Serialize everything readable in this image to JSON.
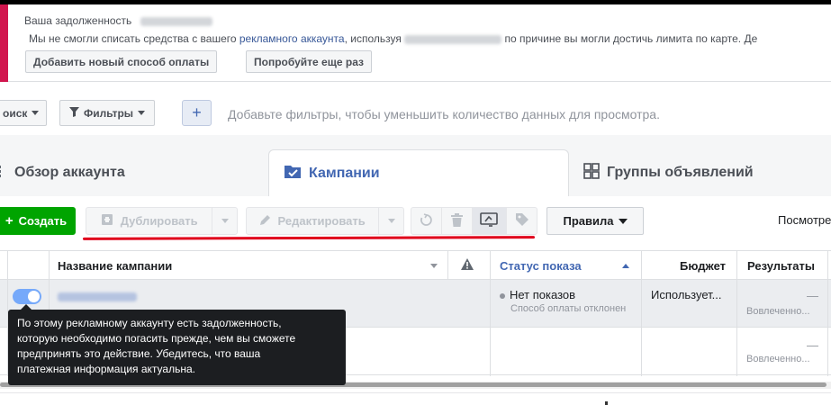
{
  "alert": {
    "title": "Ваша задолженность",
    "message_prefix": "Мы не смогли списать средства с вашего ",
    "message_link": "рекламного аккаунта",
    "message_middle": ", используя ",
    "message_suffix": " по причине вы могли достичь лимита по карте. Де",
    "add_payment_label": "Добавить новый способ оплаты",
    "retry_label": "Попробуйте еще раз",
    "accent_color": "#d1164e"
  },
  "filters": {
    "search_label": "оиск",
    "filters_label": "Фильтры",
    "add_label": "+",
    "hint": "Добавьте фильтры, чтобы уменьшить количество данных для просмотра."
  },
  "tabs": [
    {
      "label": "Обзор аккаунта",
      "icon": "overview-icon"
    },
    {
      "label": "Кампании",
      "icon": "folder-icon"
    },
    {
      "label": "Группы объявлений",
      "icon": "grid-icon"
    }
  ],
  "toolbar": {
    "create_label": "Создать",
    "duplicate_label": "Дублировать",
    "edit_label": "Редактировать",
    "rules_label": "Правила",
    "preview_label": "Посмотре",
    "create_color": "#00a400"
  },
  "table": {
    "columns": {
      "name": "Название кампании",
      "status": "Статус показа",
      "budget": "Бюджет",
      "results": "Результаты"
    },
    "rows": [
      {
        "status": "Нет показов",
        "status_sub": "Способ оплаты отклонен",
        "budget": "Использует...",
        "results": "—",
        "results_sub": "Вовлеченно...",
        "action_hint": "ровать"
      },
      {
        "results": "—",
        "results_sub": "Вовлеченно..."
      }
    ]
  },
  "tooltip": {
    "line1": "По этому рекламному аккаунту есть задолженность,",
    "line2": "которую необходимо погасить прежде, чем вы сможете",
    "line3": "предпринять это действие. Убедитесь, что ваша",
    "line4": "платежная информация актуальна."
  }
}
